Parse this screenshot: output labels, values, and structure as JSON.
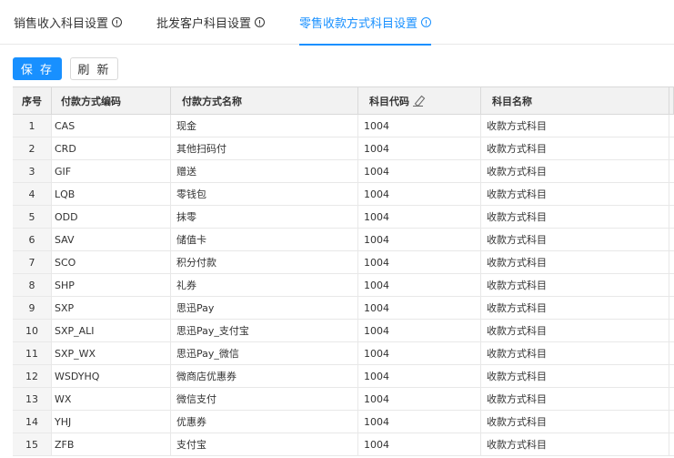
{
  "tabs": [
    {
      "label": "销售收入科目设置",
      "active": false
    },
    {
      "label": "批发客户科目设置",
      "active": false
    },
    {
      "label": "零售收款方式科目设置",
      "active": true
    }
  ],
  "toolbar": {
    "save_label": "保 存",
    "refresh_label": "刷 新"
  },
  "table": {
    "headers": [
      "序号",
      "付款方式编码",
      "付款方式名称",
      "科目代码",
      "科目名称"
    ],
    "rows": [
      [
        "1",
        "CAS",
        "现金",
        "1004",
        "收款方式科目"
      ],
      [
        "2",
        "CRD",
        "其他扫码付",
        "1004",
        "收款方式科目"
      ],
      [
        "3",
        "GIF",
        "赠送",
        "1004",
        "收款方式科目"
      ],
      [
        "4",
        "LQB",
        "零钱包",
        "1004",
        "收款方式科目"
      ],
      [
        "5",
        "ODD",
        "抹零",
        "1004",
        "收款方式科目"
      ],
      [
        "6",
        "SAV",
        "储值卡",
        "1004",
        "收款方式科目"
      ],
      [
        "7",
        "SCO",
        "积分付款",
        "1004",
        "收款方式科目"
      ],
      [
        "8",
        "SHP",
        "礼券",
        "1004",
        "收款方式科目"
      ],
      [
        "9",
        "SXP",
        "思迅Pay",
        "1004",
        "收款方式科目"
      ],
      [
        "10",
        "SXP_ALI",
        "思迅Pay_支付宝",
        "1004",
        "收款方式科目"
      ],
      [
        "11",
        "SXP_WX",
        "思迅Pay_微信",
        "1004",
        "收款方式科目"
      ],
      [
        "12",
        "WSDYHQ",
        "微商店优惠券",
        "1004",
        "收款方式科目"
      ],
      [
        "13",
        "WX",
        "微信支付",
        "1004",
        "收款方式科目"
      ],
      [
        "14",
        "YHJ",
        "优惠券",
        "1004",
        "收款方式科目"
      ],
      [
        "15",
        "ZFB",
        "支付宝",
        "1004",
        "收款方式科目"
      ]
    ]
  },
  "colors": {
    "accent": "#1890ff",
    "header_bg": "#f2f2f2",
    "border": "#e8e8e8"
  },
  "icons": {
    "tab_info": "info-circle-icon",
    "edit": "pencil-icon"
  }
}
